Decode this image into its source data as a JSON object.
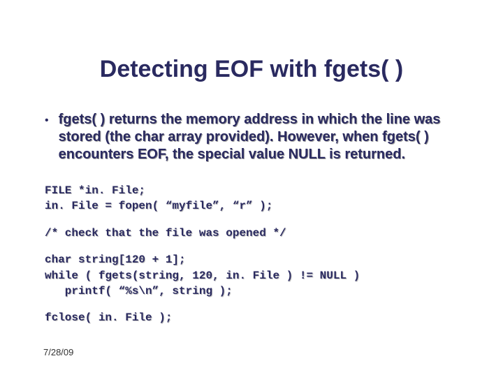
{
  "title": "Detecting EOF with fgets( )",
  "bullet": {
    "text": "fgets( ) returns the memory address in which the line was stored (the char array provided). However, when fgets( ) encounters EOF, the special value NULL is returned."
  },
  "code": {
    "block1": "FILE *in. File;\nin. File = fopen( “myfile”, “r” );",
    "block2": "/* check that the file was opened */",
    "block3": "char string[120 + 1];\nwhile ( fgets(string, 120, in. File ) != NULL )\n   printf( “%s\\n”, string );",
    "block4": "fclose( in. File );"
  },
  "date": "7/28/09"
}
